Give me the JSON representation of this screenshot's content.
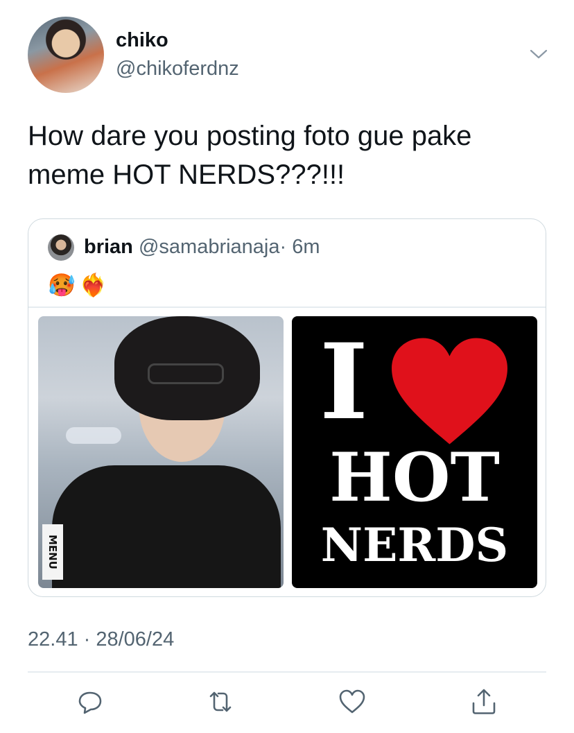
{
  "tweet": {
    "author_name": "chiko",
    "author_handle": "@chikoferdnz",
    "text": "How dare you posting foto gue pake meme HOT NERDS???!!!",
    "timestamp": "22.41 · 28/06/24"
  },
  "quote": {
    "author_name": "brian",
    "author_handle": "@samabrianaja",
    "time": "· 6m",
    "emoji": "🥵❤️‍🔥",
    "images": {
      "left_jacket_label": "MENU",
      "right_meme": {
        "line1": "I",
        "line2": "HOT",
        "line3": "NERDS"
      }
    }
  },
  "icons": {
    "chevron": "chevron-down-icon",
    "reply": "reply-icon",
    "retweet": "retweet-icon",
    "like": "heart-icon",
    "share": "share-icon"
  },
  "colors": {
    "secondary_text": "#536471",
    "border": "#cfd9de",
    "heart_red": "#e0111b"
  }
}
